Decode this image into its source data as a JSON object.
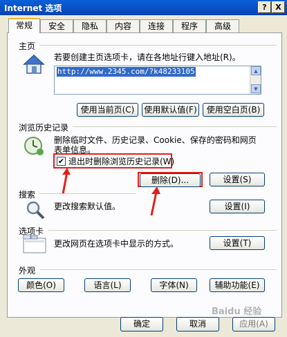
{
  "window": {
    "title": "Internet 选项",
    "help_btn": "?",
    "close_btn": "X"
  },
  "tabs": [
    {
      "label": "常规",
      "active": true
    },
    {
      "label": "安全"
    },
    {
      "label": "隐私"
    },
    {
      "label": "内容"
    },
    {
      "label": "连接"
    },
    {
      "label": "程序"
    },
    {
      "label": "高级"
    }
  ],
  "home": {
    "section": "主页",
    "desc": "若要创建主页选项卡，请在各地址行键入地址(R)。",
    "url": "http://www.2345.com/?k48233105",
    "btn_current": "使用当前页(C)",
    "btn_default": "使用默认值(F)",
    "btn_blank": "使用空白页(B)"
  },
  "history": {
    "section": "浏览历史记录",
    "desc_line1": "删除临时文件、历史记录、Cookie、保存的密码和网页",
    "desc_line2": "表单信息。",
    "checkbox_label": "退出时删除浏览历史记录(W)",
    "checkbox_checked": true,
    "btn_delete": "删除(D)...",
    "btn_settings": "设置(S)"
  },
  "search": {
    "section": "搜索",
    "desc": "更改搜索默认值。",
    "btn_settings": "设置(I)"
  },
  "tabsec": {
    "section": "选项卡",
    "desc": "更改网页在选项卡中显示的方式。",
    "btn_settings": "设置(T)"
  },
  "appearance": {
    "section": "外观",
    "btn_colors": "颜色(O)",
    "btn_languages": "语言(L)",
    "btn_fonts": "字体(N)",
    "btn_accessibility": "辅助功能(E)"
  },
  "footer": {
    "ok": "确定",
    "cancel": "取消",
    "apply": "应用(A)"
  },
  "watermark": "Baidu 经验",
  "colors": {
    "annotation": "#e0201c",
    "titlebar": "#0a5fd8"
  }
}
